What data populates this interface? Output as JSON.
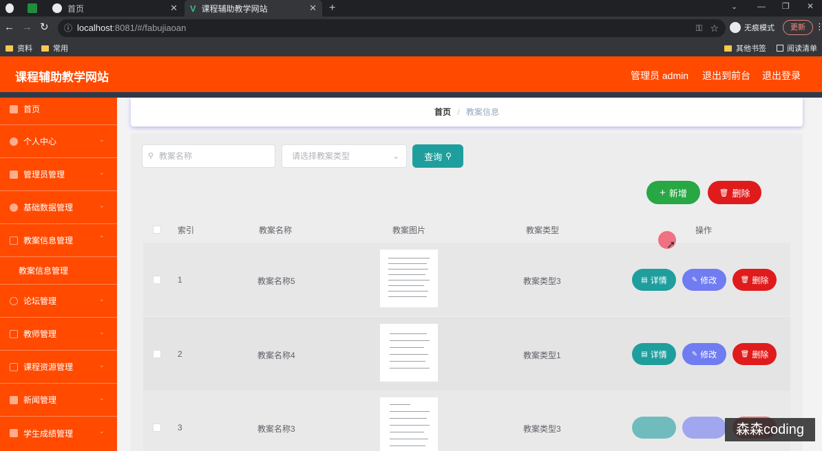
{
  "browser": {
    "tabs": [
      {
        "label": ""
      },
      {
        "label": ""
      },
      {
        "label": "首页"
      },
      {
        "label": "课程辅助教学网站"
      }
    ],
    "url_host": "localhost",
    "url_rest": ":8081/#/fabujiaoan",
    "incognito_label": "无痕模式",
    "update_label": "更新",
    "bookmarks": [
      "资料",
      "常用"
    ],
    "bookmarks_right": [
      "其他书签",
      "阅读清单"
    ]
  },
  "header": {
    "title": "课程辅助教学网站",
    "admin_label": "管理员 admin",
    "front_label": "退出到前台",
    "logout_label": "退出登录"
  },
  "sidebar": {
    "items": [
      {
        "label": "首页"
      },
      {
        "label": "个人中心"
      },
      {
        "label": "管理员管理"
      },
      {
        "label": "基础数据管理"
      },
      {
        "label": "教案信息管理"
      },
      {
        "label": "教案信息管理"
      },
      {
        "label": "论坛管理"
      },
      {
        "label": "教师管理"
      },
      {
        "label": "课程资源管理"
      },
      {
        "label": "新闻管理"
      },
      {
        "label": "学生成绩管理"
      }
    ]
  },
  "breadcrumb": {
    "home": "首页",
    "sep": "/",
    "current": "教案信息"
  },
  "search": {
    "name_placeholder": "教案名称",
    "type_placeholder": "请选择教案类型",
    "query_label": "查询"
  },
  "actions": {
    "add_label": "新增",
    "delete_label": "删除"
  },
  "table": {
    "headers": [
      "索引",
      "教案名称",
      "教案图片",
      "教案类型",
      "操作"
    ],
    "rows": [
      {
        "index": "1",
        "name": "教案名称5",
        "type": "教案类型3"
      },
      {
        "index": "2",
        "name": "教案名称4",
        "type": "教案类型1"
      },
      {
        "index": "3",
        "name": "教案名称3",
        "type": "教案类型3"
      }
    ],
    "detail_label": "详情",
    "edit_label": "修改",
    "delete_label": "删除"
  },
  "watermark": "森森coding",
  "colors": {
    "brand": "#ff4a00",
    "teal": "#1f9e9e",
    "green": "#28a745",
    "red": "#e01b1b",
    "purple": "#6f7cf2"
  }
}
